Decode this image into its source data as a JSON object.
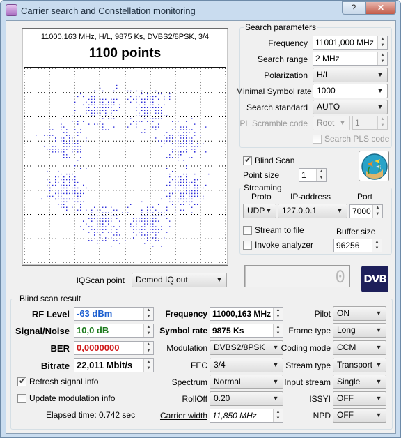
{
  "window": {
    "title": "Carrier search and Constellation monitoring",
    "help_label": "?",
    "close_label": "✕"
  },
  "plot": {
    "subtitle": "11000,163 MHz, H/L, 9875 Ks, DVBS2/8PSK, 3/4",
    "points_label": "1100 points"
  },
  "iqscan": {
    "label": "IQScan point",
    "value": "Demod IQ out"
  },
  "search": {
    "title": "Search parameters",
    "frequency_label": "Frequency",
    "frequency_value": "11001,000 MHz",
    "range_label": "Search range",
    "range_value": "2 MHz",
    "polarization_label": "Polarization",
    "polarization_value": "H/L",
    "msr_label": "Minimal Symbol rate",
    "msr_value": "1000",
    "standard_label": "Search standard",
    "standard_value": "AUTO",
    "plscramble_label": "PL Scramble code",
    "plscramble_mode": "Root",
    "plscramble_value": "1",
    "searchpls_label": "Search PLS code"
  },
  "blindscan": {
    "label": "Blind Scan",
    "checked": true,
    "pointsize_label": "Point size",
    "pointsize_value": "1"
  },
  "streaming": {
    "title": "Streaming",
    "proto_label": "Proto",
    "proto_value": "UDP",
    "ip_label": "IP-address",
    "ip_value": "127.0.0.1",
    "port_label": "Port",
    "port_value": "7000",
    "stream_to_file_label": "Stream to file",
    "invoke_analyzer_label": "Invoke analyzer",
    "buffer_label": "Buffer size",
    "buffer_value": "96256"
  },
  "lcd": {
    "value": "0"
  },
  "dvb_logo": "DVB",
  "result": {
    "title": "Blind scan result",
    "rf_label": "RF Level",
    "rf_value": "-63 dBm",
    "snr_label": "Signal/Noise",
    "snr_value": "10,0 dB",
    "ber_label": "BER",
    "ber_value": "0,0000000",
    "bitrate_label": "Bitrate",
    "bitrate_value": "22,011 Mbit/s",
    "refresh_label": "Refresh signal info",
    "update_label": "Update modulation info",
    "elapsed": "Elapsed time: 0.742 sec",
    "freq_label": "Frequency",
    "freq_value": "11000,163 MHz",
    "sr_label": "Symbol rate",
    "sr_value": "9875 Ks",
    "modulation_label": "Modulation",
    "modulation_value": "DVBS2/8PSK",
    "fec_label": "FEC",
    "fec_value": "3/4",
    "spectrum_label": "Spectrum",
    "spectrum_value": "Normal",
    "rolloff_label": "RollOff",
    "rolloff_value": "0.20",
    "carrier_label": "Carrier width",
    "carrier_value": "11,850 MHz",
    "pilot_label": "Pilot",
    "pilot_value": "ON",
    "frame_label": "Frame type",
    "frame_value": "Long",
    "coding_label": "Coding mode",
    "coding_value": "CCM",
    "streamtype_label": "Stream type",
    "streamtype_value": "Transport",
    "inputstream_label": "Input stream",
    "inputstream_value": "Single",
    "issyi_label": "ISSYI",
    "issyi_value": "OFF",
    "npd_label": "NPD",
    "npd_value": "OFF"
  },
  "constellation": {
    "modulation": "8PSK",
    "points": 1100,
    "symbol_ring_radius": 0.64,
    "colors": {
      "dot": "#2c2cd8",
      "grid": "#000000",
      "lcd_digit": "#b8b8b8",
      "dvb_logo_bg": "#1d1f5a"
    }
  }
}
